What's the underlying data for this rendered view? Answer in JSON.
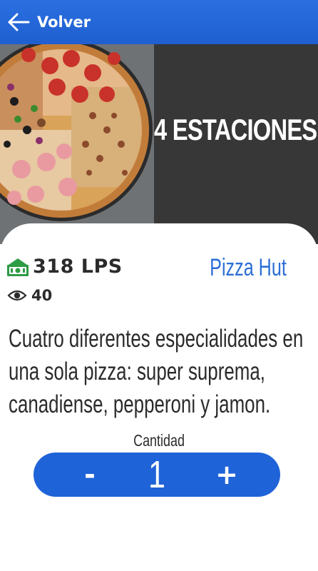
{
  "header": {
    "back_label": "Volver",
    "back_icon": "arrow-left-icon",
    "background_color": "#1f5fd0"
  },
  "hero": {
    "title": "4 ESTACIONES",
    "image": "pizza-image"
  },
  "product": {
    "price": "318 LPS",
    "price_icon": "money-icon",
    "views": "40",
    "views_icon": "eye-icon",
    "brand": "Pizza Hut",
    "brand_color": "#2d6fd6",
    "description": "Cuatro diferentes especialidades en una sola pizza: super suprema, canadiense, pepperoni y jamon."
  },
  "quantity": {
    "label": "Cantidad",
    "minus_label": "-",
    "value": "1",
    "plus_label": "+",
    "stepper_color": "#1f63d8"
  }
}
